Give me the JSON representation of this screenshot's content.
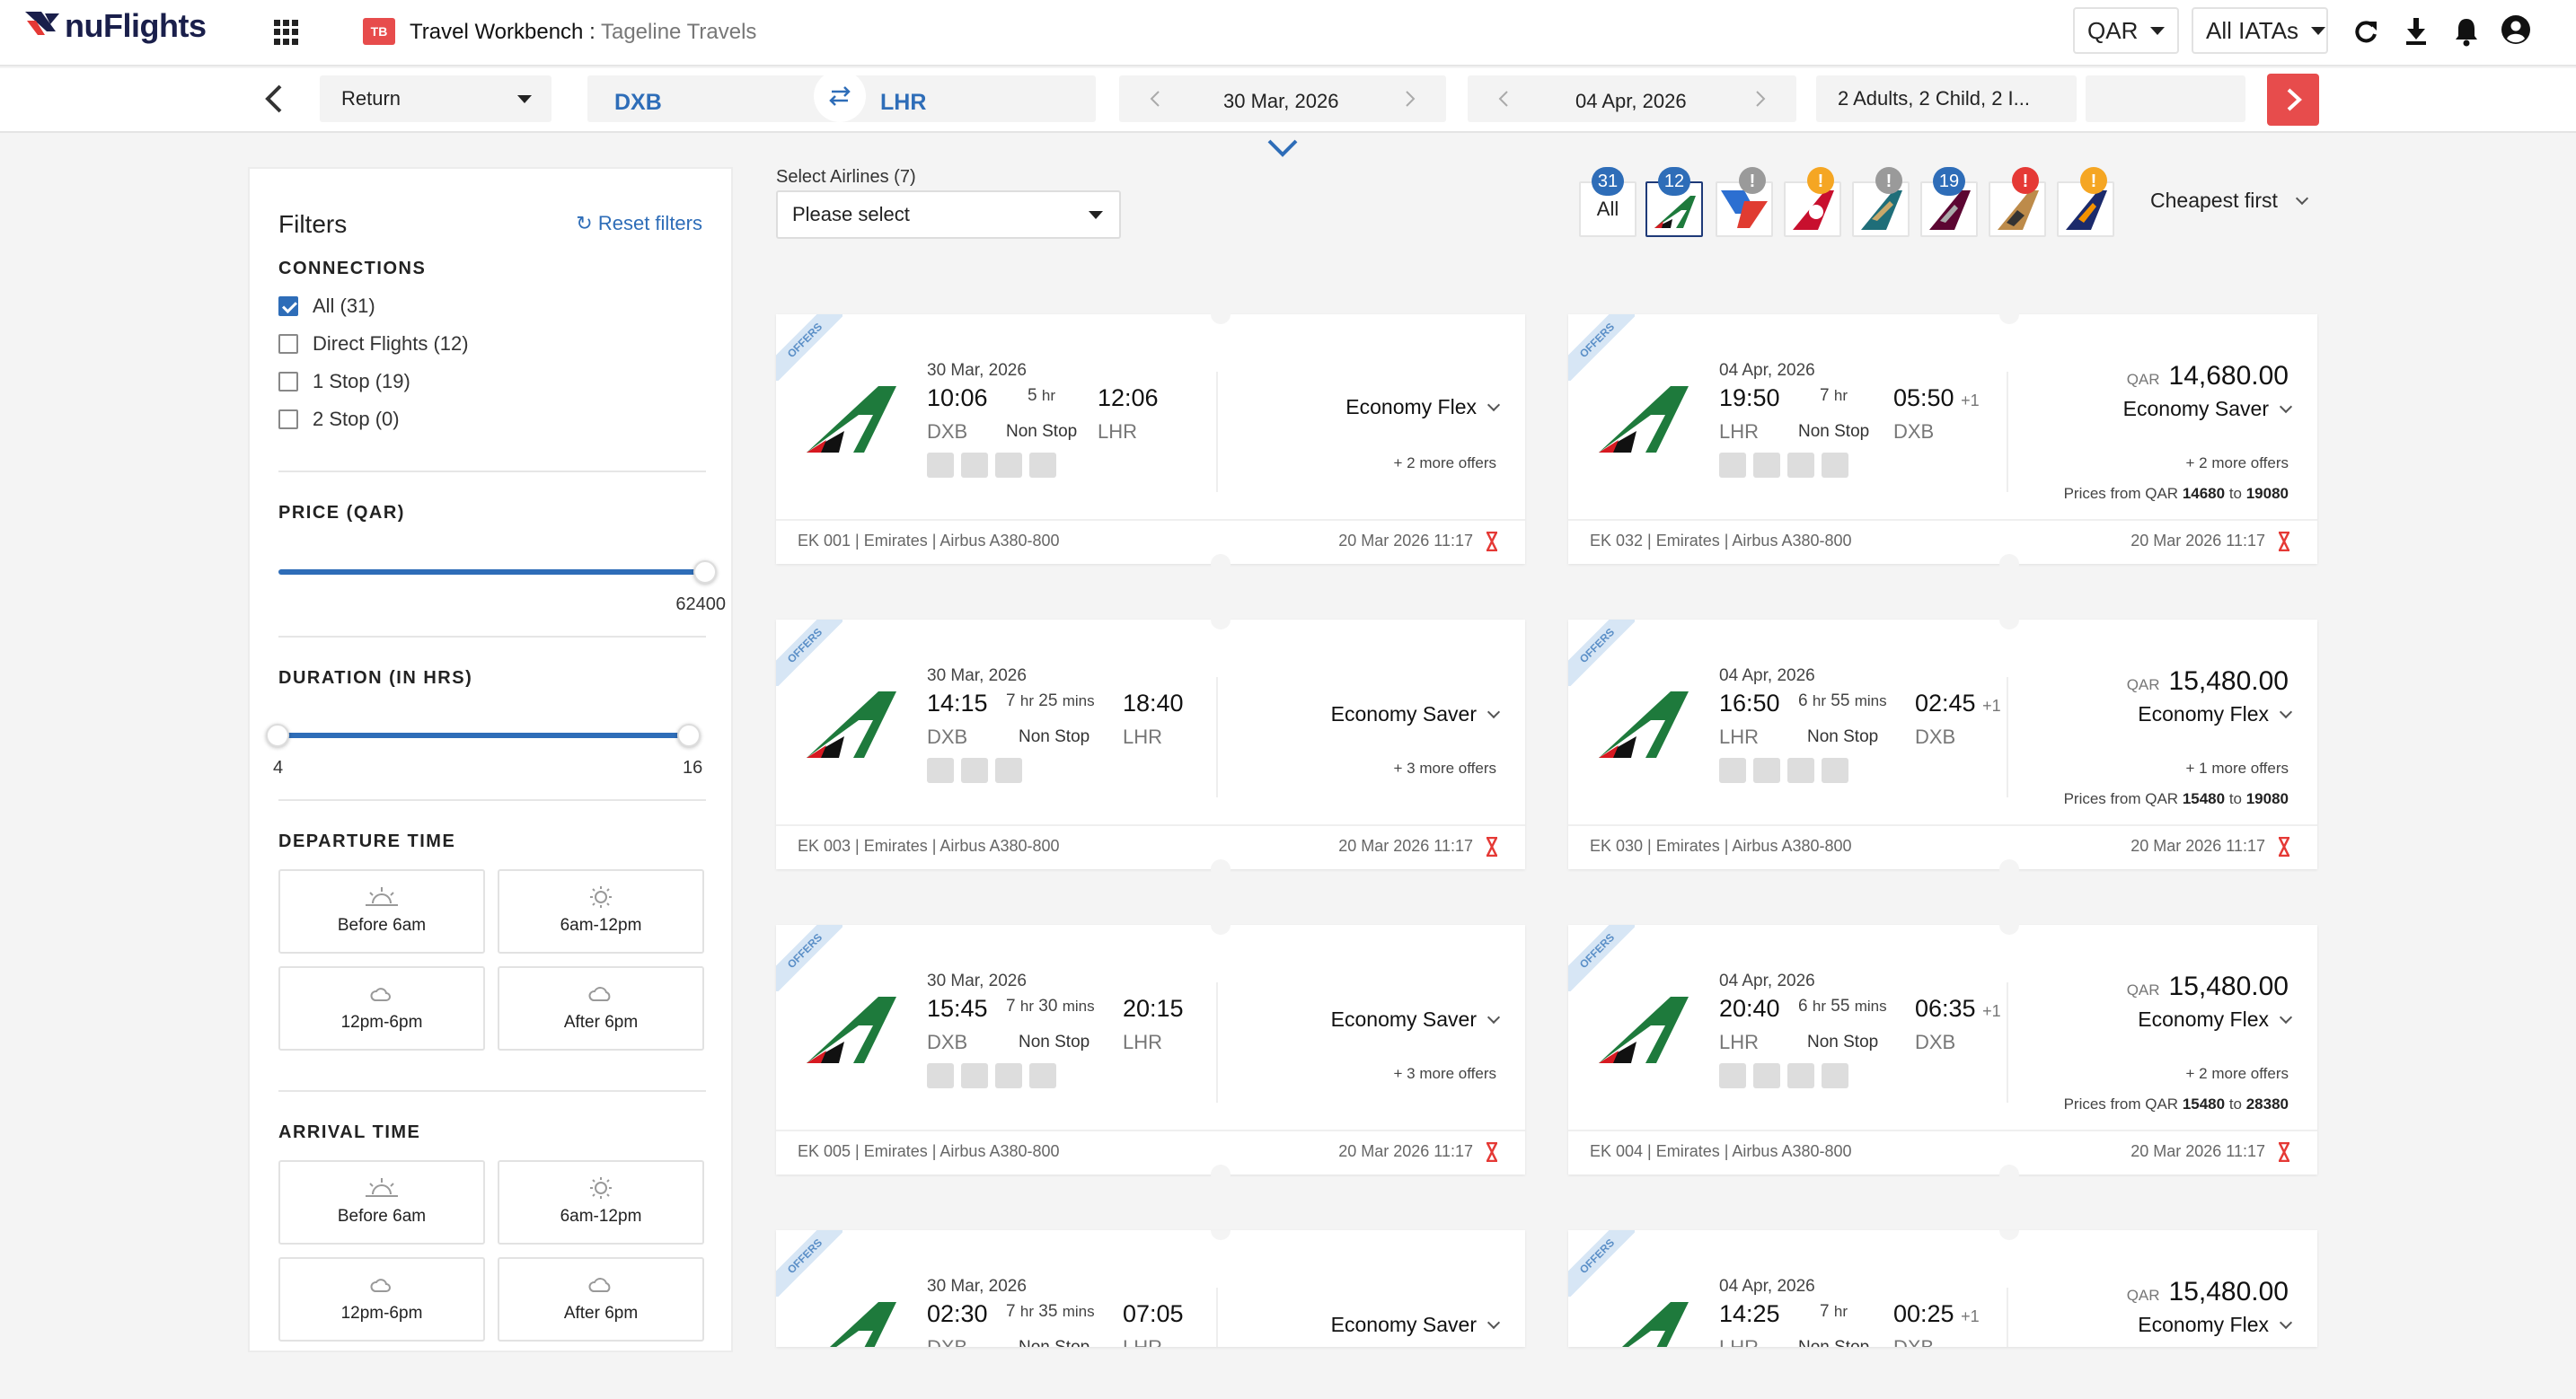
{
  "app": {
    "logo_text": "nuFlights",
    "workbench_icon": "TB",
    "title": "Travel Workbench",
    "title_sep": " : ",
    "subtitle": "Tageline Travels"
  },
  "topbar": {
    "currency": "QAR",
    "iata": "All IATAs"
  },
  "search": {
    "trip_type": "Return",
    "from": "DXB",
    "to": "LHR",
    "depart_date": "30 Mar, 2026",
    "return_date": "04 Apr, 2026",
    "passengers": "2 Adults, 2 Child, 2 I..."
  },
  "filters": {
    "title": "Filters",
    "reset": "Reset filters",
    "connections_title": "CONNECTIONS",
    "connections": [
      {
        "label": "All (31)",
        "checked": true
      },
      {
        "label": "Direct Flights (12)",
        "checked": false
      },
      {
        "label": "1 Stop (19)",
        "checked": false
      },
      {
        "label": "2 Stop (0)",
        "checked": false
      }
    ],
    "price_title": "PRICE (QAR)",
    "price_max": "62400",
    "duration_title": "DURATION (IN HRS)",
    "duration_min": "4",
    "duration_max": "16",
    "departure_title": "DEPARTURE TIME",
    "arrival_title": "ARRIVAL TIME",
    "times": [
      "Before 6am",
      "6am-12pm",
      "12pm-6pm",
      "After 6pm"
    ]
  },
  "airlines": {
    "label": "Select Airlines (7)",
    "placeholder": "Please select",
    "all": "All",
    "all_count": "31",
    "emirates_count": "12",
    "qatar_count": "19",
    "alert": "!",
    "sort": "Cheapest first"
  },
  "outbound": [
    {
      "offers": "OFFERS",
      "date": "30 Mar, 2026",
      "dep": "10:06",
      "arr": "12:06",
      "dur_h": "5",
      "dur_m": "",
      "dur_label_h": "hr",
      "dur_label_m": "",
      "from": "DXB",
      "to": "LHR",
      "stops": "Non Stop",
      "fare": "Economy Flex",
      "more": "+ 2 more offers",
      "flight": "EK 001 | Emirates | Airbus A380-800",
      "stamp": "20 Mar 2026 11:17"
    },
    {
      "offers": "OFFERS",
      "date": "30 Mar, 2026",
      "dep": "14:15",
      "arr": "18:40",
      "dur_h": "7",
      "dur_m": "25",
      "dur_label_h": "hr",
      "dur_label_m": "mins",
      "from": "DXB",
      "to": "LHR",
      "stops": "Non Stop",
      "fare": "Economy Saver",
      "more": "+ 3 more offers",
      "flight": "EK 003 | Emirates | Airbus A380-800",
      "stamp": "20 Mar 2026 11:17"
    },
    {
      "offers": "OFFERS",
      "date": "30 Mar, 2026",
      "dep": "15:45",
      "arr": "20:15",
      "dur_h": "7",
      "dur_m": "30",
      "dur_label_h": "hr",
      "dur_label_m": "mins",
      "from": "DXB",
      "to": "LHR",
      "stops": "Non Stop",
      "fare": "Economy Saver",
      "more": "+ 3 more offers",
      "flight": "EK 005 | Emirates | Airbus A380-800",
      "stamp": "20 Mar 2026 11:17"
    },
    {
      "offers": "OFFERS",
      "date": "30 Mar, 2026",
      "dep": "02:30",
      "arr": "07:05",
      "dur_h": "7",
      "dur_m": "35",
      "dur_label_h": "hr",
      "dur_label_m": "mins",
      "from": "DXB",
      "to": "LHR",
      "stops": "Non Stop",
      "fare": "Economy Saver"
    }
  ],
  "inbound": [
    {
      "offers": "OFFERS",
      "date": "04 Apr, 2026",
      "dep": "19:50",
      "arr": "05:50",
      "next": "+1",
      "dur_h": "7",
      "dur_m": "",
      "dur_label_h": "hr",
      "dur_label_m": "",
      "from": "LHR",
      "to": "DXB",
      "stops": "Non Stop",
      "currency": "QAR",
      "price": "14,680.00",
      "fare": "Economy Saver",
      "more": "+ 2 more offers",
      "pf_pre": "Prices from QAR ",
      "pf_lo": "14680",
      "pf_mid": " to ",
      "pf_hi": "19080",
      "flight": "EK 032 | Emirates | Airbus A380-800",
      "stamp": "20 Mar 2026 11:17"
    },
    {
      "offers": "OFFERS",
      "date": "04 Apr, 2026",
      "dep": "16:50",
      "arr": "02:45",
      "next": "+1",
      "dur_h": "6",
      "dur_m": "55",
      "dur_label_h": "hr",
      "dur_label_m": "mins",
      "from": "LHR",
      "to": "DXB",
      "stops": "Non Stop",
      "currency": "QAR",
      "price": "15,480.00",
      "fare": "Economy Flex",
      "more": "+ 1 more offers",
      "pf_pre": "Prices from QAR ",
      "pf_lo": "15480",
      "pf_mid": " to ",
      "pf_hi": "19080",
      "flight": "EK 030 | Emirates | Airbus A380-800",
      "stamp": "20 Mar 2026 11:17"
    },
    {
      "offers": "OFFERS",
      "date": "04 Apr, 2026",
      "dep": "20:40",
      "arr": "06:35",
      "next": "+1",
      "dur_h": "6",
      "dur_m": "55",
      "dur_label_h": "hr",
      "dur_label_m": "mins",
      "from": "LHR",
      "to": "DXB",
      "stops": "Non Stop",
      "currency": "QAR",
      "price": "15,480.00",
      "fare": "Economy Flex",
      "more": "+ 2 more offers",
      "pf_pre": "Prices from QAR ",
      "pf_lo": "15480",
      "pf_mid": " to ",
      "pf_hi": "28380",
      "flight": "EK 004 | Emirates | Airbus A380-800",
      "stamp": "20 Mar 2026 11:17"
    },
    {
      "offers": "OFFERS",
      "date": "04 Apr, 2026",
      "dep": "14:25",
      "arr": "00:25",
      "next": "+1",
      "dur_h": "7",
      "dur_m": "",
      "dur_label_h": "hr",
      "dur_label_m": "",
      "from": "LHR",
      "to": "DXB",
      "stops": "Non Stop",
      "currency": "QAR",
      "price": "15,480.00",
      "fare": "Economy Flex"
    }
  ],
  "colors": {
    "accent": "#2e6db8",
    "danger": "#e74c4c",
    "brand": "#1a1f4b"
  }
}
